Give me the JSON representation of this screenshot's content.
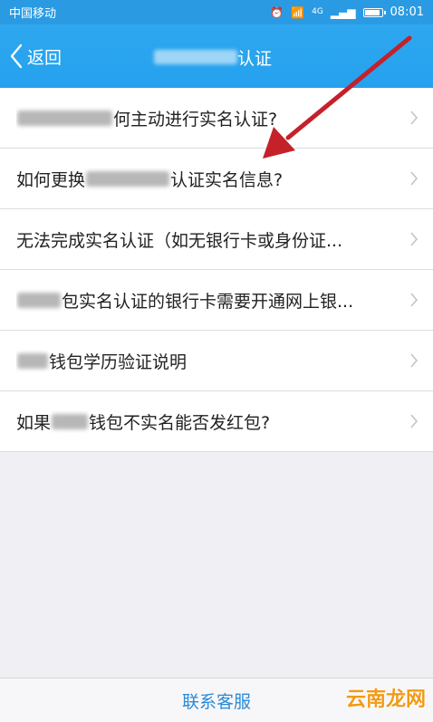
{
  "status_bar": {
    "carrier": "中国移动",
    "time": "08:01",
    "net": "4G"
  },
  "nav": {
    "back_label": "返回",
    "title_visible": "认证"
  },
  "list": {
    "items": [
      {
        "prefix": "",
        "text": "何主动进行实名认证?"
      },
      {
        "prefix": "如何更换",
        "text": "认证实名信息?"
      },
      {
        "prefix": "",
        "text": "无法完成实名认证（如无银行卡或身份证..."
      },
      {
        "prefix": "",
        "text": "包实名认证的银行卡需要开通网上银..."
      },
      {
        "prefix": "",
        "text": "钱包学历验证说明"
      },
      {
        "prefix": "如果",
        "text": "钱包不实名能否发红包?"
      }
    ]
  },
  "footer": {
    "contact_label": "联系客服"
  },
  "watermark": "云南龙网",
  "colors": {
    "nav_bg": "#2ea7ef",
    "link": "#2a8ad8",
    "arrow": "#c4212b"
  }
}
